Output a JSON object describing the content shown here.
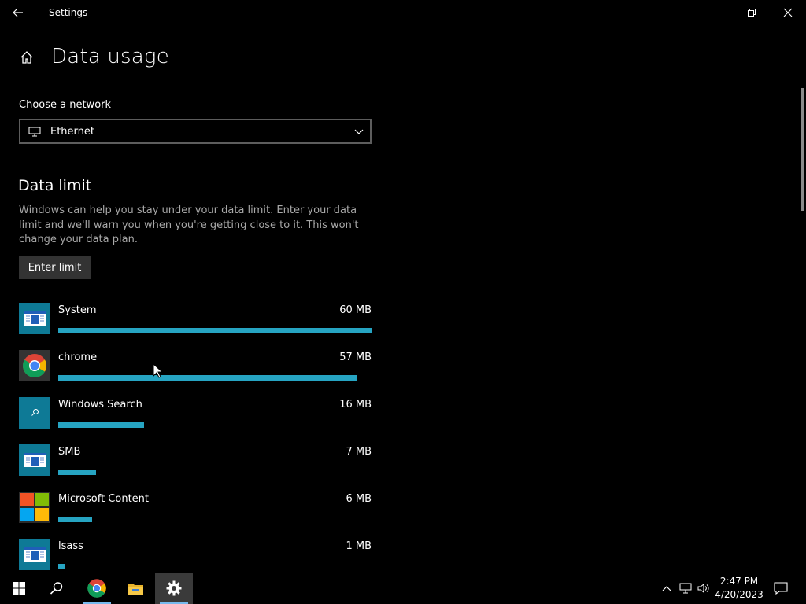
{
  "window": {
    "title": "Settings"
  },
  "page": {
    "title": "Data usage"
  },
  "network": {
    "label": "Choose a network",
    "selected": "Ethernet"
  },
  "data_limit": {
    "title": "Data limit",
    "description": "Windows can help you stay under your data limit. Enter your data limit and we'll warn you when you're getting close to it. This won't change your data plan.",
    "button_label": "Enter limit"
  },
  "apps": [
    {
      "name": "System",
      "usage": "60 MB",
      "fraction": 1.0,
      "icon": "system-app-icon"
    },
    {
      "name": "chrome",
      "usage": "57 MB",
      "fraction": 0.955,
      "icon": "chrome-icon"
    },
    {
      "name": "Windows Search",
      "usage": "16 MB",
      "fraction": 0.275,
      "icon": "search-app-icon"
    },
    {
      "name": "SMB",
      "usage": "7 MB",
      "fraction": 0.12,
      "icon": "system-app-icon"
    },
    {
      "name": "Microsoft Content",
      "usage": "6 MB",
      "fraction": 0.108,
      "icon": "microsoft-logo-icon"
    },
    {
      "name": "lsass",
      "usage": "1 MB",
      "fraction": 0.02,
      "icon": "system-app-icon"
    }
  ],
  "colors": {
    "accent": "#26a4c2",
    "app_tile": "#0e7a96",
    "background": "#000000",
    "taskbar_active": "#3a3a3a"
  },
  "taskbar": {
    "time": "2:47 PM",
    "date": "4/20/2023"
  }
}
